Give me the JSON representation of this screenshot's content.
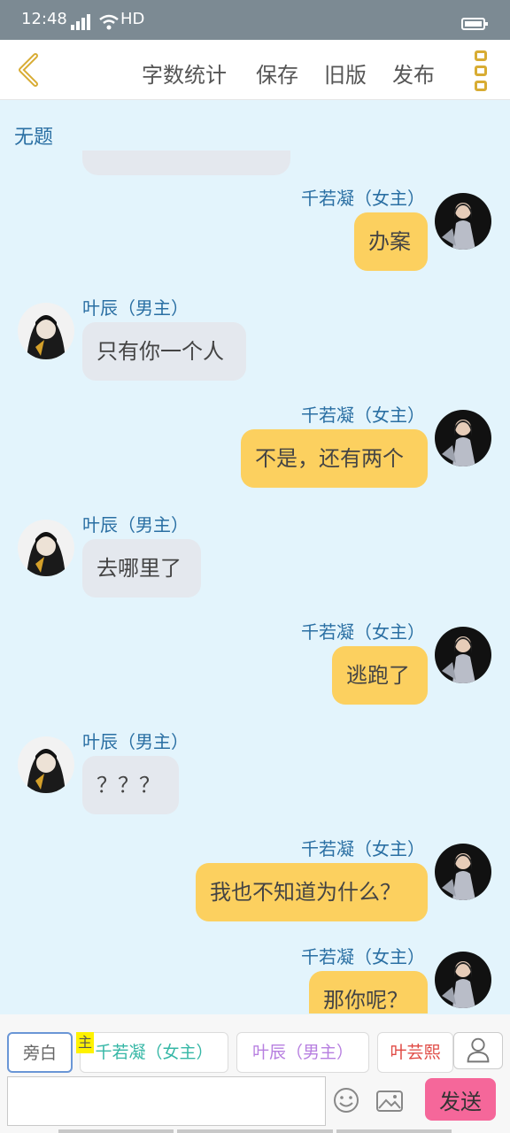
{
  "status_bar": {
    "time": "12:48",
    "network": "4G",
    "hd": "HD"
  },
  "toolbar": {
    "word_count": "字数统计",
    "save": "保存",
    "old_version": "旧版",
    "publish": "发布"
  },
  "story": {
    "title": "无题"
  },
  "messages": [
    {
      "side": "right",
      "speaker": "千若凝（女主）",
      "text": "办案"
    },
    {
      "side": "left",
      "speaker": "叶辰（男主）",
      "text": "只有你一个人"
    },
    {
      "side": "right",
      "speaker": "千若凝（女主）",
      "text": "不是，还有两个"
    },
    {
      "side": "left",
      "speaker": "叶辰（男主）",
      "text": "去哪里了"
    },
    {
      "side": "right",
      "speaker": "千若凝（女主）",
      "text": "逃跑了"
    },
    {
      "side": "left",
      "speaker": "叶辰（男主）",
      "text": "？？？"
    },
    {
      "side": "right",
      "speaker": "千若凝（女主）",
      "text": "我也不知道为什么？"
    },
    {
      "side": "right",
      "speaker": "千若凝（女主）",
      "text": "那你呢？"
    }
  ],
  "roles": {
    "items": [
      {
        "label": "旁白",
        "color": "#666666"
      },
      {
        "label": "千若凝（女主）",
        "color": "#36b7a6"
      },
      {
        "label": "叶辰（男主）",
        "color": "#b77fe0"
      },
      {
        "label": "叶芸熙",
        "color": "#e04a44"
      }
    ],
    "main_tag": "主"
  },
  "input": {
    "placeholder": "",
    "send": "发送"
  },
  "colors": {
    "chat_bg": "#e3f4fc",
    "right_bubble": "#fcd05f",
    "left_bubble": "#e4e8ee",
    "speaker_name": "#2a6fa3",
    "send_button": "#f5679a",
    "accent_icon": "#d8ac33"
  }
}
